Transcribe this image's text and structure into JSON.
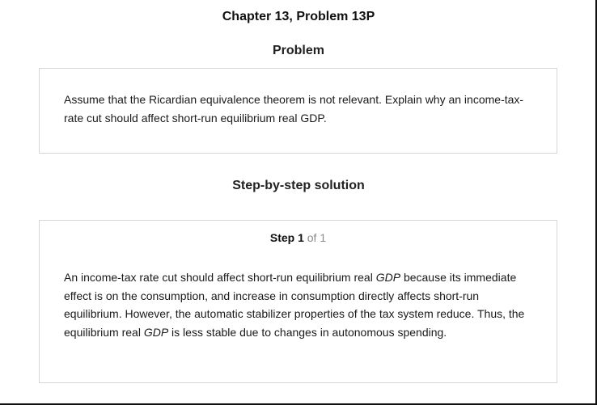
{
  "header": {
    "chapter_title": "Chapter 13, Problem 13P"
  },
  "problem": {
    "heading": "Problem",
    "text": "Assume that the Ricardian equivalence theorem is not relevant. Explain why an income-tax-rate cut should affect short-run equilibrium real GDP."
  },
  "solution": {
    "heading": "Step-by-step solution",
    "step_word": "Step 1",
    "step_of": " of 1",
    "segments": [
      "An income-tax rate cut should affect short-run equilibrium real ",
      "GDP",
      " because its immediate effect is on the consumption, and increase in consumption directly affects short-run equilibrium. However, the automatic stabilizer properties of the tax system reduce. Thus, the equilibrium real ",
      "GDP",
      " is less stable due to changes in autonomous spending."
    ]
  }
}
